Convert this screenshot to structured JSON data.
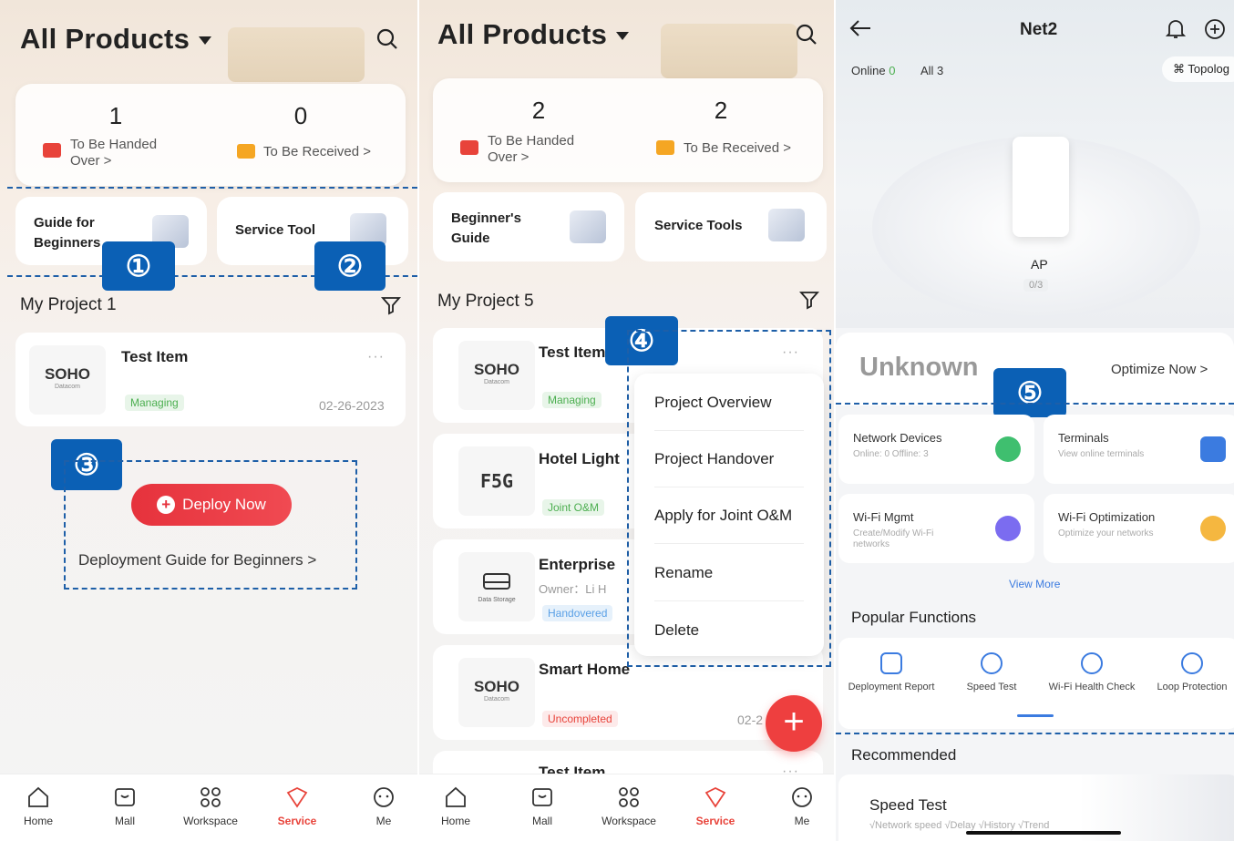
{
  "screen1": {
    "title": "All Products",
    "stats": [
      {
        "value": "1",
        "label": "To Be Handed Over"
      },
      {
        "value": "0",
        "label": "To Be Received"
      }
    ],
    "tools": [
      {
        "label": "Guide for Beginners"
      },
      {
        "label": "Service Tool"
      }
    ],
    "badges": [
      "①",
      "②",
      "③"
    ],
    "section": "My Project",
    "section_count": "1",
    "project": {
      "logo": "SOHO",
      "logo_sub": "Datacom",
      "name": "Test Item",
      "status": "Managing",
      "date": "02-26-2023",
      "more": "···"
    },
    "deploy_button": "Deploy Now",
    "deploy_guide": "Deployment Guide for Beginners >"
  },
  "screen2": {
    "title": "All Products",
    "stats": [
      {
        "value": "2",
        "label": "To Be Handed Over"
      },
      {
        "value": "2",
        "label": "To Be Received"
      }
    ],
    "tools": [
      {
        "label": "Beginner's Guide"
      },
      {
        "label": "Service Tools"
      }
    ],
    "badge": "④",
    "section": "My Project",
    "section_count": "5",
    "projects": [
      {
        "logo": "SOHO",
        "logo_sub": "Datacom",
        "name": "Test Item",
        "status": "Managing"
      },
      {
        "logo": "F5G",
        "name": "Hotel Light",
        "status": "Joint O&M"
      },
      {
        "logo_sub": "Data Storage",
        "name": "Enterprise",
        "owner": "Owner：Li H",
        "status": "Handovered"
      },
      {
        "logo": "SOHO",
        "logo_sub": "Datacom",
        "name": "Smart Home",
        "status": "Uncompleted",
        "date": "02-2"
      },
      {
        "name": "Test Item"
      }
    ],
    "menu": [
      "Project Overview",
      "Project Handover",
      "Apply for Joint O&M",
      "Rename",
      "Delete"
    ],
    "fab": "+"
  },
  "screen3": {
    "title": "Net2",
    "online_label": "Online",
    "online_count": "0",
    "all_label": "All 3",
    "topology": "Topolog",
    "device": {
      "name": "AP",
      "count": "0/3"
    },
    "health": "Unknown",
    "optimize": "Optimize Now",
    "badge": "⑤",
    "functions": [
      {
        "title": "Network Devices",
        "sub": "Online: 0 Offline: 3"
      },
      {
        "title": "Terminals",
        "sub": "View online terminals"
      },
      {
        "title": "Wi-Fi Mgmt",
        "sub": "Create/Modify Wi-Fi networks"
      },
      {
        "title": "Wi-Fi Optimization",
        "sub": "Optimize your networks"
      }
    ],
    "view_more": "View More",
    "popular_title": "Popular Functions",
    "popular": [
      "Deployment Report",
      "Speed Test",
      "Wi-Fi Health Check",
      "Loop Protection"
    ],
    "recommended": "Recommended",
    "speed_test": "Speed Test",
    "speed_sub": "√Network speed  √Delay  √History  √Trend"
  },
  "tabbar": {
    "tabs": [
      "Home",
      "Mall",
      "Workspace",
      "Service",
      "Me"
    ],
    "active": "Service"
  },
  "colors": {
    "accent_red": "#e8433a",
    "annotation_blue": "#0b60b5",
    "tag_green": "#4caf50"
  }
}
